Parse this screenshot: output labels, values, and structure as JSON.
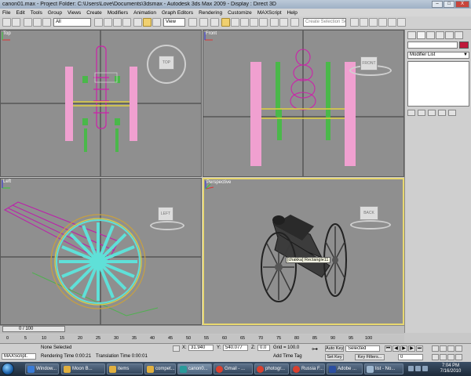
{
  "window": {
    "title": "canon01.max   - Project Folder: C:\\Users\\Love\\Documents\\3dsmax   - Autodesk 3ds Max  2009   - Display : Direct 3D",
    "min_label": "–",
    "max_label": "□",
    "close_label": "X"
  },
  "menu": [
    "File",
    "Edit",
    "Tools",
    "Group",
    "Views",
    "Create",
    "Modifiers",
    "Animation",
    "Graph Editors",
    "Rendering",
    "Customize",
    "MAXScript",
    "Help"
  ],
  "toolbar": {
    "filter_value": "All",
    "refcoord_value": "View",
    "selection_set_placeholder": "Create Selection Set"
  },
  "viewports": {
    "top": {
      "label": "Top",
      "cube_label": "TOP"
    },
    "front": {
      "label": "Front",
      "cube_label": "FRONT"
    },
    "left": {
      "label": "Left",
      "cube_label": "LEFT"
    },
    "perspective": {
      "label": "Perspective",
      "cube_label": "BACK",
      "tooltip": "[chakka] Rectangle11"
    }
  },
  "command_panel": {
    "modifier_list": "Modifier List"
  },
  "timeline": {
    "frame": "0 / 100",
    "ticks": [
      "0",
      "5",
      "10",
      "15",
      "20",
      "25",
      "30",
      "35",
      "40",
      "45",
      "50",
      "55",
      "60",
      "65",
      "70",
      "75",
      "80",
      "85",
      "90",
      "95",
      "100"
    ]
  },
  "status": {
    "maxscript": "MAXScript.",
    "selection": "None Selected",
    "rendering_time": "Rendering Time  0:00:21",
    "translation_time": "Translation Time  0:00:01",
    "x_label": "X:",
    "x_value": "31.940",
    "y_label": "Y:",
    "y_value": "540.077",
    "z_label": "Z:",
    "z_value": "0.0",
    "grid": "Grid = 100.0",
    "add_time_tag": "Add Time Tag",
    "auto_key": "Auto Key",
    "set_key": "Set Key",
    "selected": "Selected",
    "key_filters": "Key Filters...",
    "frame_field": "0"
  },
  "taskbar": {
    "items": [
      {
        "label": "Window...",
        "color": "#3a7bd5"
      },
      {
        "label": "Moon B...",
        "color": "#e0b040"
      },
      {
        "label": "items",
        "color": "#e0b040"
      },
      {
        "label": "compet...",
        "color": "#e0b040"
      },
      {
        "label": "canon0...",
        "color": "#2a9a9a"
      },
      {
        "label": "Gmail - ...",
        "color": "#d9402f"
      },
      {
        "label": "photogr...",
        "color": "#d9402f"
      },
      {
        "label": "Russia F...",
        "color": "#d9402f"
      },
      {
        "label": "Adobe ...",
        "color": "#2b4ea0"
      },
      {
        "label": "list - No...",
        "color": "#9fb8d0"
      }
    ],
    "time": "7:04 PM",
    "date": "7/16/2010"
  }
}
